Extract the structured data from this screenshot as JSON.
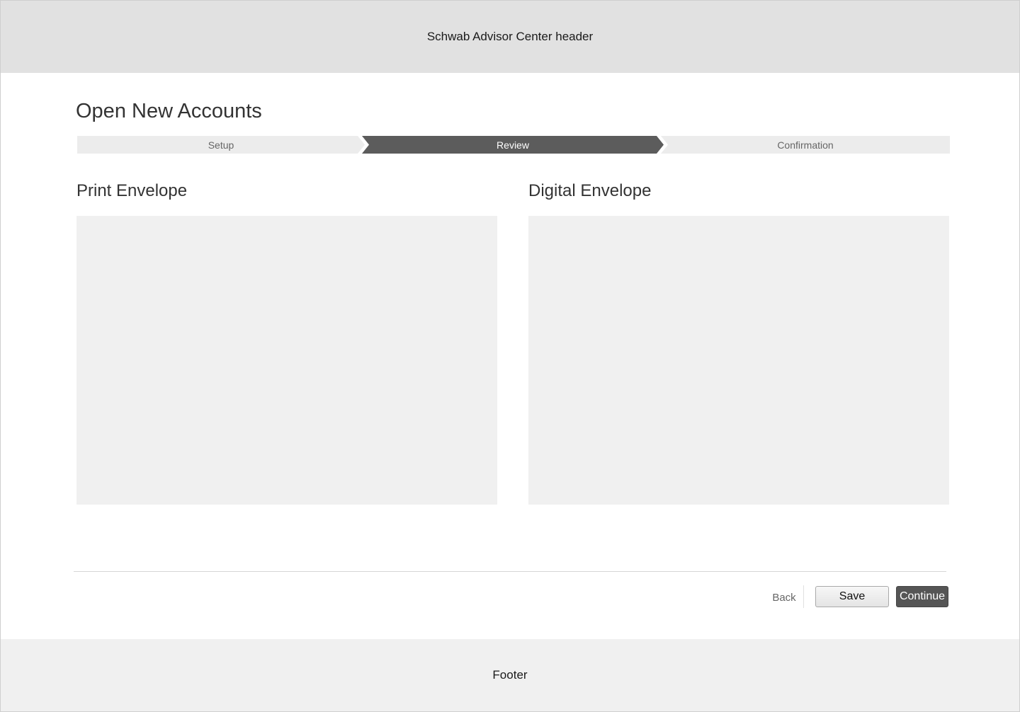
{
  "header": {
    "text": "Schwab Advisor Center header"
  },
  "page": {
    "title": "Open New Accounts"
  },
  "stepper": {
    "steps": [
      {
        "label": "Setup",
        "active": false
      },
      {
        "label": "Review",
        "active": true
      },
      {
        "label": "Confirmation",
        "active": false
      }
    ]
  },
  "sections": {
    "print_title": "Print Envelope",
    "digital_title": "Digital Envelope"
  },
  "actions": {
    "back_label": "Back",
    "save_label": "Save",
    "continue_label": "Continue"
  },
  "footer": {
    "text": "Footer"
  },
  "colors": {
    "active_step": "#5c5c5c",
    "inactive_step": "#ececec",
    "header_bg": "#e1e1e1",
    "footer_bg": "#f0f0f0",
    "panel_bg": "#f0f0f0",
    "primary_button": "#555555"
  }
}
